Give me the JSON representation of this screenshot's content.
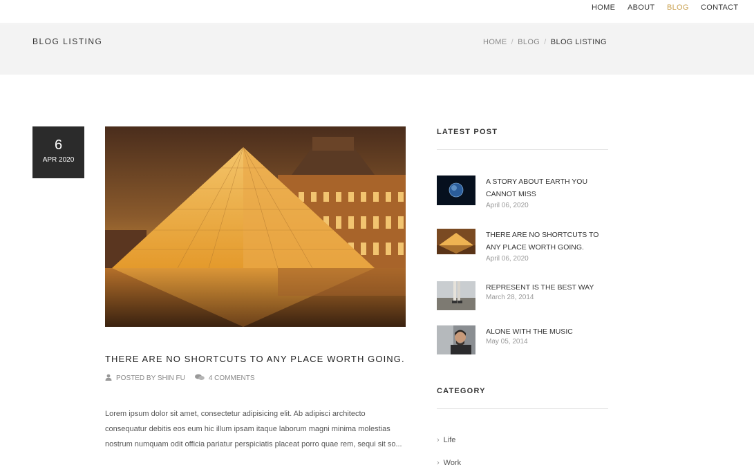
{
  "nav": {
    "items": [
      {
        "label": "HOME"
      },
      {
        "label": "ABOUT"
      },
      {
        "label": "BLOG"
      },
      {
        "label": "CONTACT"
      }
    ],
    "active_color": "#c9a04e"
  },
  "page": {
    "title": "BLOG LISTING",
    "breadcrumb": [
      "HOME",
      "BLOG",
      "BLOG LISTING"
    ]
  },
  "post": {
    "day": "6",
    "month_year": "APR 2020",
    "title": "THERE ARE NO SHORTCUTS TO ANY PLACE WORTH GOING.",
    "author_text": "POSTED BY SHIN FU",
    "comments_text": "4 COMMENTS",
    "excerpt": "Lorem ipsum dolor sit amet, consectetur adipisicing elit. Ab adipisci architecto consequatur debitis eos eum hic illum ipsam itaque laborum magni minima molestias nostrum numquam odit officia pariatur perspiciatis placeat porro quae rem, sequi sit so...",
    "icons": {
      "author": "user-icon",
      "comments": "comments-icon"
    }
  },
  "sidebar": {
    "latest_heading": "LATEST POST",
    "latest": [
      {
        "title": "A STORY ABOUT EARTH YOU CANNOT MISS",
        "date": "April 06, 2020"
      },
      {
        "title": "THERE ARE NO SHORTCUTS TO ANY PLACE WORTH GOING.",
        "date": "April 06, 2020"
      },
      {
        "title": "REPRESENT IS THE BEST WAY",
        "date": "March 28, 2014"
      },
      {
        "title": "ALONE WITH THE MUSIC",
        "date": "May 05, 2014"
      }
    ],
    "category_heading": "CATEGORY",
    "categories": [
      "Life",
      "Work"
    ]
  }
}
